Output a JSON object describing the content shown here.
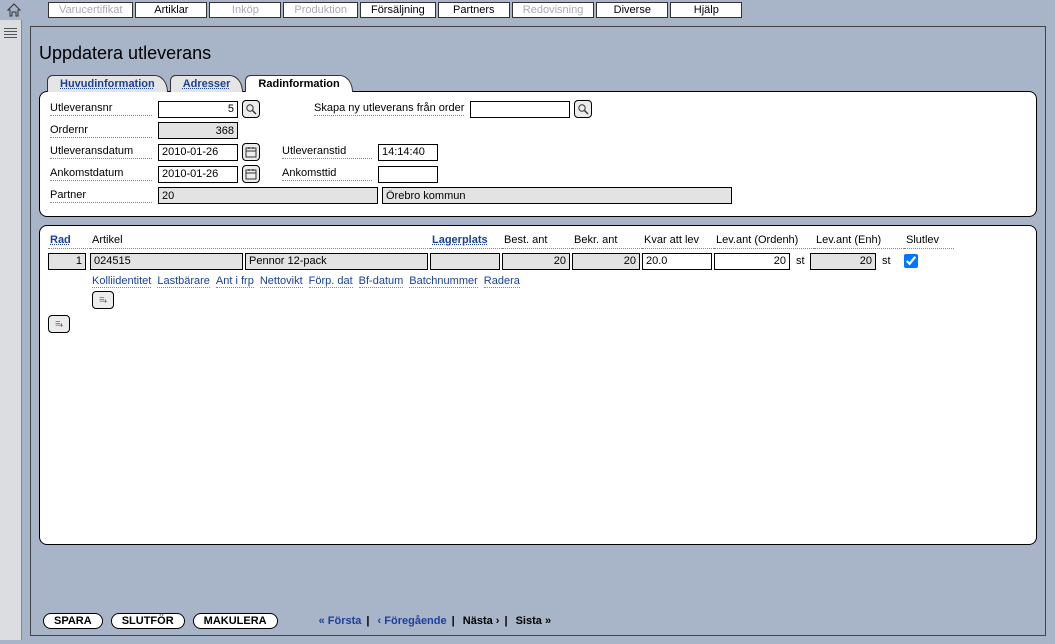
{
  "topTabs": [
    {
      "label": "Varucertifikat",
      "disabled": true
    },
    {
      "label": "Artiklar",
      "disabled": false
    },
    {
      "label": "Inköp",
      "disabled": true
    },
    {
      "label": "Produktion",
      "disabled": true
    },
    {
      "label": "Försäljning",
      "disabled": false
    },
    {
      "label": "Partners",
      "disabled": false
    },
    {
      "label": "Redovisning",
      "disabled": true
    },
    {
      "label": "Diverse",
      "disabled": false
    },
    {
      "label": "Hjälp",
      "disabled": false
    }
  ],
  "pageTitle": "Uppdatera utleverans",
  "subtabs": {
    "huvud": "Huvudinformation",
    "adresser": "Adresser",
    "rad": "Radinformation"
  },
  "form": {
    "utlevnr_label": "Utleveransnr",
    "utlevnr_value": "5",
    "ordernr_label": "Ordernr",
    "ordernr_value": "368",
    "utlevdatum_label": "Utleveransdatum",
    "utlevdatum_value": "2010-01-26",
    "utlevtid_label": "Utleveranstid",
    "utlevtid_value": "14:14:40",
    "ankdatum_label": "Ankomstdatum",
    "ankdatum_value": "2010-01-26",
    "anktid_label": "Ankomsttid",
    "anktid_value": "",
    "partner_label": "Partner",
    "partner_code": "20",
    "partner_name": "Örebro kommun",
    "skapa_label": "Skapa ny utleverans från order",
    "skapa_value": ""
  },
  "grid": {
    "headers": {
      "rad": "Rad",
      "artikel": "Artikel",
      "lagerplats": "Lagerplats",
      "best": "Best. ant",
      "bekr": "Bekr. ant",
      "kvar": "Kvar att lev",
      "lo": "Lev.ant (Ordenh)",
      "le": "Lev.ant (Enh)",
      "slut": "Slutlev"
    },
    "row": {
      "rad": "1",
      "art_code": "024515",
      "art_desc": "Pennor 12-pack",
      "lagerplats": "",
      "best": "20",
      "bekr": "20",
      "kvar": "20.0",
      "lo": "20",
      "lo_unit": "st",
      "le": "20",
      "le_unit": "st",
      "slut": true
    },
    "subheaders": [
      "Kolliidentitet",
      "Lastbärare",
      "Ant i frp",
      "Nettovikt",
      "Förp. dat",
      "Bf-datum",
      "Batchnummer",
      "Radera"
    ]
  },
  "footer": {
    "spara": "SPARA",
    "slutfor": "SLUTFÖR",
    "makulera": "MAKULERA",
    "forsta": "« Första",
    "foreg": "‹ Föregående",
    "nasta": "Nästa ›",
    "sista": "Sista »"
  }
}
